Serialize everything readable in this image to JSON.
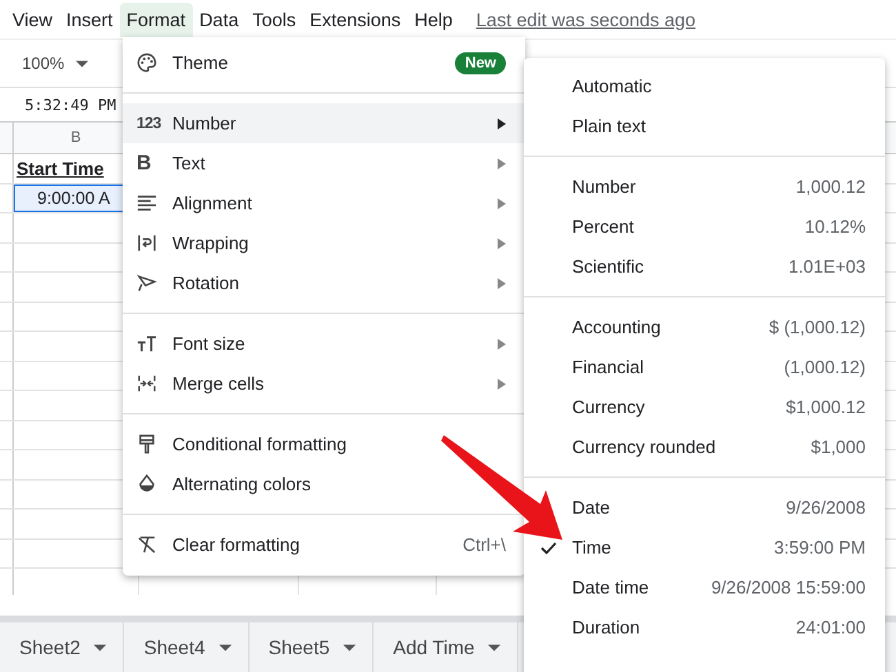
{
  "menubar": {
    "items": [
      {
        "label": "View",
        "selected": false
      },
      {
        "label": "Insert",
        "selected": false
      },
      {
        "label": "Format",
        "selected": true
      },
      {
        "label": "Data",
        "selected": false
      },
      {
        "label": "Tools",
        "selected": false
      },
      {
        "label": "Extensions",
        "selected": false
      },
      {
        "label": "Help",
        "selected": false
      }
    ],
    "last_edit": "Last edit was seconds ago"
  },
  "toolbar": {
    "zoom": "100%"
  },
  "formula_bar": {
    "value": "5:32:49 PM"
  },
  "sheet": {
    "column_header": "B",
    "header_cell": "Start Time",
    "value_cell": "9:00:00 A"
  },
  "format_menu": {
    "sections": [
      [
        {
          "label": "Theme",
          "badge": "New",
          "submenu": false,
          "highlighted": false
        }
      ],
      [
        {
          "glyph": "123",
          "label": "Number",
          "submenu": true,
          "highlighted": true
        },
        {
          "glyph": "B",
          "label": "Text",
          "submenu": true,
          "highlighted": false
        },
        {
          "label": "Alignment",
          "submenu": true,
          "highlighted": false
        },
        {
          "label": "Wrapping",
          "submenu": true,
          "highlighted": false
        },
        {
          "label": "Rotation",
          "submenu": true,
          "highlighted": false
        }
      ],
      [
        {
          "label": "Font size",
          "submenu": true,
          "highlighted": false
        },
        {
          "label": "Merge cells",
          "submenu": true,
          "highlighted": false
        }
      ],
      [
        {
          "label": "Conditional formatting",
          "submenu": false,
          "highlighted": false
        },
        {
          "label": "Alternating colors",
          "submenu": false,
          "highlighted": false
        }
      ],
      [
        {
          "label": "Clear formatting",
          "shortcut": "Ctrl+\\",
          "submenu": false,
          "highlighted": false
        }
      ]
    ]
  },
  "number_submenu": {
    "sections": [
      [
        {
          "label": "Automatic",
          "checked": false
        },
        {
          "label": "Plain text",
          "checked": false
        }
      ],
      [
        {
          "label": "Number",
          "example": "1,000.12",
          "checked": false
        },
        {
          "label": "Percent",
          "example": "10.12%",
          "checked": false
        },
        {
          "label": "Scientific",
          "example": "1.01E+03",
          "checked": false
        }
      ],
      [
        {
          "label": "Accounting",
          "example": "$ (1,000.12)",
          "checked": false
        },
        {
          "label": "Financial",
          "example": "(1,000.12)",
          "checked": false
        },
        {
          "label": "Currency",
          "example": "$1,000.12",
          "checked": false
        },
        {
          "label": "Currency rounded",
          "example": "$1,000",
          "checked": false
        }
      ],
      [
        {
          "label": "Date",
          "example": "9/26/2008",
          "checked": false
        },
        {
          "label": "Time",
          "example": "3:59:00 PM",
          "checked": true
        },
        {
          "label": "Date time",
          "example": "9/26/2008 15:59:00",
          "checked": false
        },
        {
          "label": "Duration",
          "example": "24:01:00",
          "checked": false
        }
      ]
    ]
  },
  "sheet_tabs": [
    "Sheet2",
    "Sheet4",
    "Sheet5",
    "Add Time"
  ]
}
